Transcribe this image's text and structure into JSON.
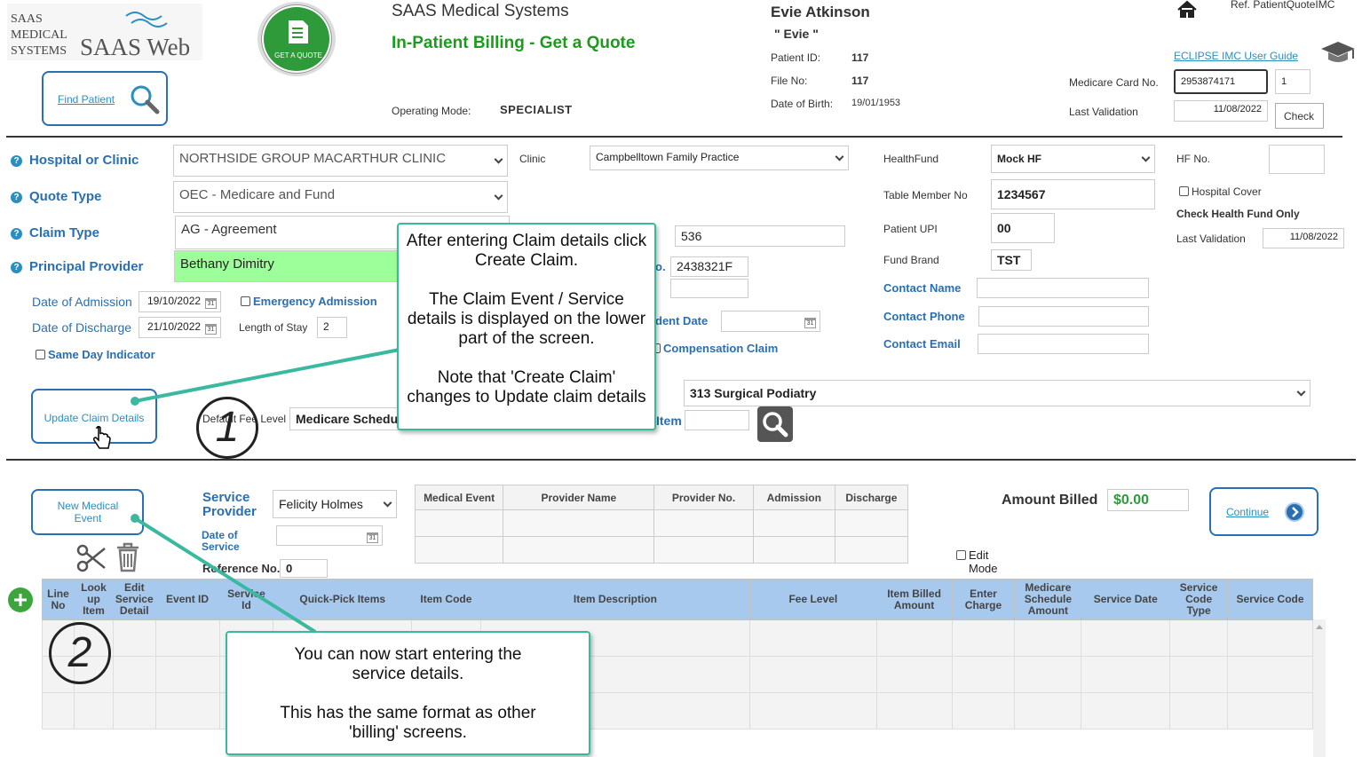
{
  "brand": {
    "logo_line1": "SAAS",
    "logo_line2": "MEDICAL",
    "logo_line3": "SYSTEMS",
    "logo_web": "SAAS Web",
    "quote_badge": "GET A QUOTE"
  },
  "header": {
    "company": "SAAS Medical Systems",
    "page_title": "In-Patient Billing - Get a Quote",
    "operating_mode_label": "Operating Mode:",
    "operating_mode_value": "SPECIALIST",
    "find_patient": "Find Patient",
    "ref": "Ref. PatientQuoteIMC",
    "guide_link": "ECLIPSE IMC User Guide"
  },
  "patient": {
    "name": "Evie Atkinson",
    "nickname": "\" Evie \"",
    "id_label": "Patient ID:",
    "id_value": "117",
    "file_label": "File No:",
    "file_value": "117",
    "dob_label": "Date of Birth:",
    "dob_value": "19/01/1953"
  },
  "medicare": {
    "card_label": "Medicare Card No.",
    "card_value": "2953874171",
    "irn_value": "1",
    "last_validation_label": "Last Validation",
    "last_validation_value": "11/08/2022",
    "check_button": "Check"
  },
  "form": {
    "hospital_label": "Hospital or Clinic",
    "hospital_value": "NORTHSIDE GROUP MACARTHUR CLINIC",
    "clinic_label": "Clinic",
    "clinic_value": "Campbelltown Family Practice",
    "quote_type_label": "Quote Type",
    "quote_type_value": "OEC - Medicare and Fund",
    "claim_type_label": "Claim Type",
    "claim_type_value": "AG - Agreement",
    "provider_label": "Principal Provider",
    "provider_value": "Bethany Dimitry",
    "field_536": "536",
    "provider_no_partial": "o.",
    "provider_no_value": "2438321F",
    "accident_date_partial": "dent Date",
    "compensation_claim": "Compensation Claim",
    "admission_label": "Date of Admission",
    "admission_value": "19/10/2022",
    "emergency_label": "Emergency Admission",
    "discharge_label": "Date of Discharge",
    "discharge_value": "21/10/2022",
    "los_label": "Length of Stay",
    "los_value": "2",
    "same_day_label": "Same Day Indicator",
    "update_button": "Update Claim Details",
    "default_fee_label": "Default Fee Level",
    "default_fee_value": "Medicare Schedu",
    "speciality_value": "313 Surgical Podiatry",
    "item_partial": "Item",
    "cal_icon_text": "31"
  },
  "fund": {
    "healthfund_label": "HealthFund",
    "healthfund_value": "Mock HF",
    "hf_no_label": "HF No.",
    "table_member_label": "Table Member No",
    "table_member_value": "1234567",
    "hospital_cover_label": "Hospital Cover",
    "check_hf_only": "Check Health Fund Only",
    "upi_label": "Patient UPI",
    "upi_value": "00",
    "last_validation_label": "Last Validation",
    "last_validation_value": "11/08/2022",
    "brand_label": "Fund Brand",
    "brand_value": "TST",
    "contact_name_label": "Contact Name",
    "contact_phone_label": "Contact Phone",
    "contact_email_label": "Contact Email"
  },
  "event": {
    "new_button": "New Medical Event",
    "service_provider_label": "Service Provider",
    "service_provider_value": "Felicity Holmes",
    "date_of_service_label": "Date of Service",
    "reference_label": "Reference No.",
    "reference_value": "0",
    "table_headers": [
      "Medical Event",
      "Provider Name",
      "Provider No.",
      "Admission",
      "Discharge"
    ],
    "amount_billed_label": "Amount Billed",
    "amount_billed_value": "$0.00",
    "continue_button": "Continue",
    "edit_mode_label": "Edit Mode"
  },
  "grid": {
    "headers": [
      "Line No",
      "Look up Item",
      "Edit Service Detail",
      "Event ID",
      "Service Id",
      "Quick-Pick Items",
      "Item Code",
      "Item Description",
      "Fee Level",
      "Item Billed Amount",
      "Enter Charge",
      "Medicare Schedule Amount",
      "Service Date",
      "Service Code Type",
      "Service Code"
    ]
  },
  "annotations": {
    "callout1_lines": [
      "After entering Claim details click Create Claim.",
      "",
      "The Claim Event / Service details is displayed on the lower part of the screen.",
      "",
      "Note that 'Create Claim' changes to Update claim details"
    ],
    "callout2_lines": [
      "You can now start entering the service details.",
      "",
      "This has the same format as other 'billing' screens."
    ],
    "step1": "1",
    "step2": "2"
  },
  "colors": {
    "accent": "#2a6fb0",
    "teal": "#3bb9a0",
    "green_highlight": "#9dff9a",
    "grid_header": "#a8c9ee",
    "title_green": "#1e9a1e"
  }
}
